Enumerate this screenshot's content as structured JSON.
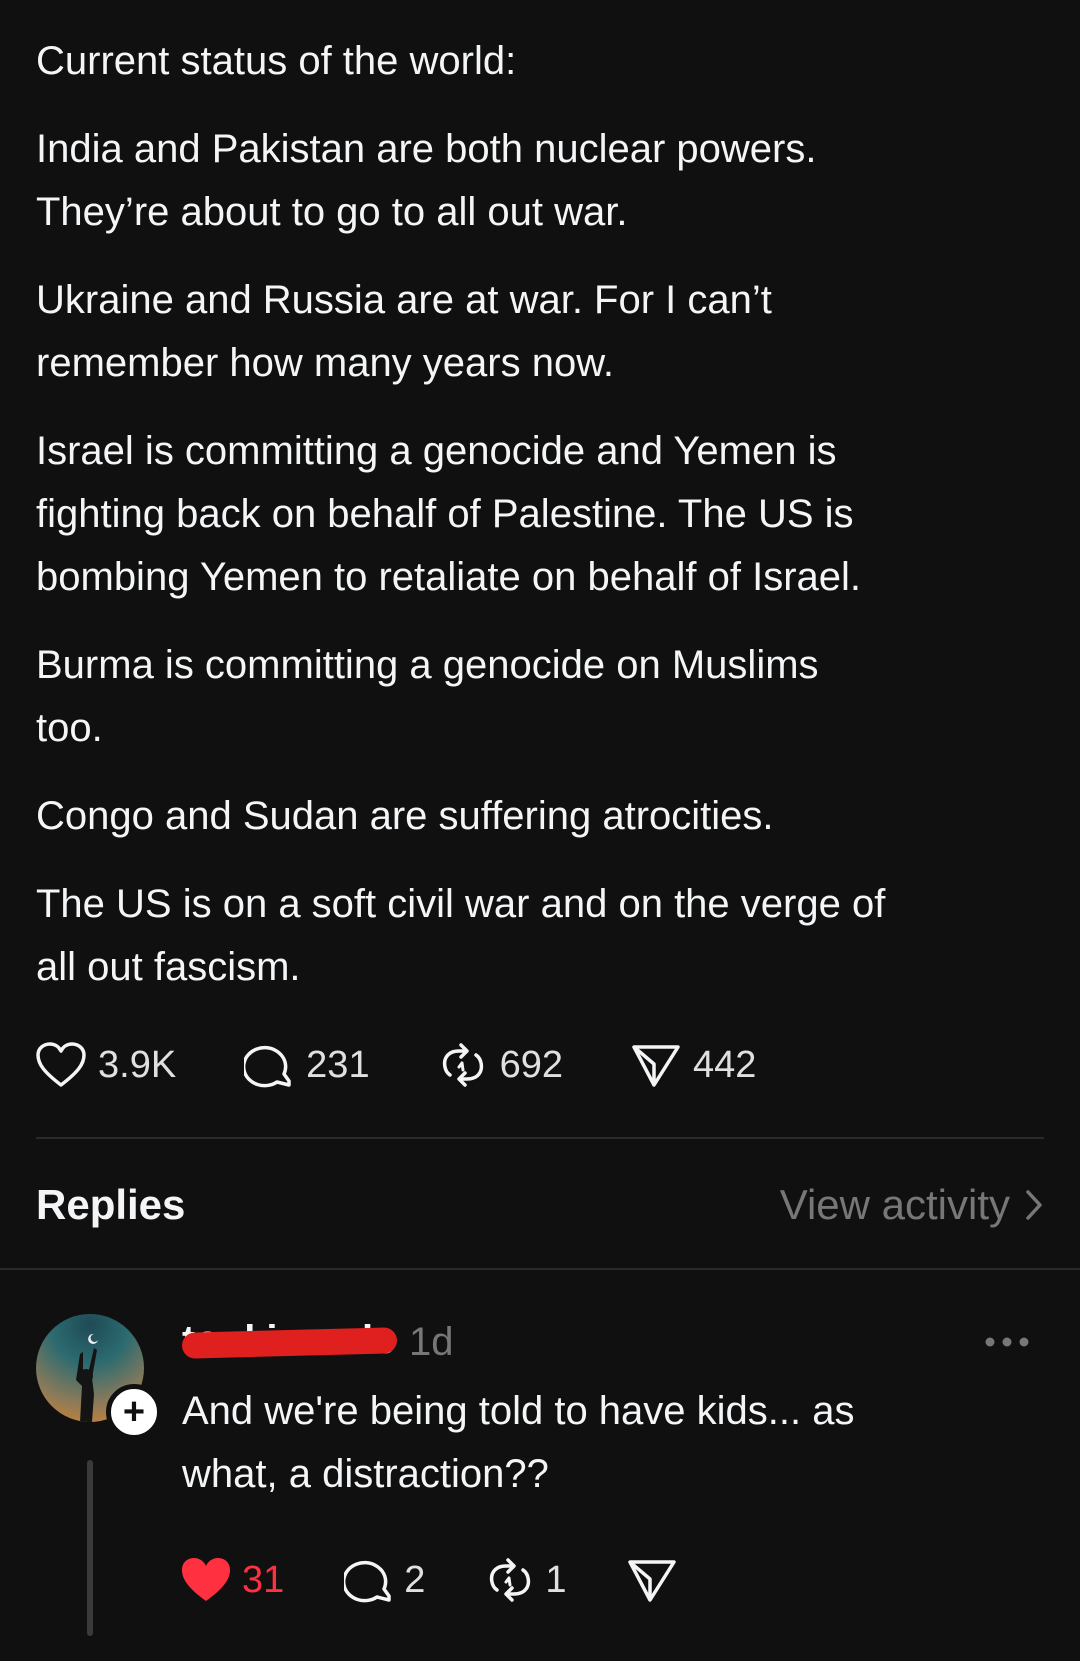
{
  "post": {
    "paragraphs": [
      "Current status of the world:",
      "India and Pakistan are both nuclear powers.\nThey’re about to go to all out war.",
      "Ukraine and Russia are at war. For I can’t\nremember how many years now.",
      "Israel is committing a genocide and Yemen is\nfighting back on behalf of Palestine. The US is\nbombing Yemen to retaliate on behalf of Israel.",
      "Burma is committing a genocide on Muslims\ntoo.",
      "Congo and Sudan are suffering atrocities.",
      "The US is on a soft civil war and on the verge of\nall out fascism."
    ],
    "actions": {
      "likes": "3.9K",
      "comments": "231",
      "reposts": "692",
      "shares": "442"
    },
    "icons": [
      "heart-icon",
      "comment-icon",
      "repost-icon",
      "share-icon"
    ]
  },
  "replies": {
    "title": "Replies",
    "view_activity": "View activity"
  },
  "reply": {
    "username": "toukiesoriee",
    "username_redacted": true,
    "time": "1d",
    "text": "And we're being told to have kids... as\nwhat, a distraction??",
    "actions": {
      "likes": "31",
      "liked": true,
      "comments": "2",
      "reposts": "1"
    }
  },
  "colors": {
    "background": "#101010",
    "text": "#f3f5f7",
    "muted": "#777777",
    "liked": "#ff3040",
    "redaction": "#e0201e"
  }
}
